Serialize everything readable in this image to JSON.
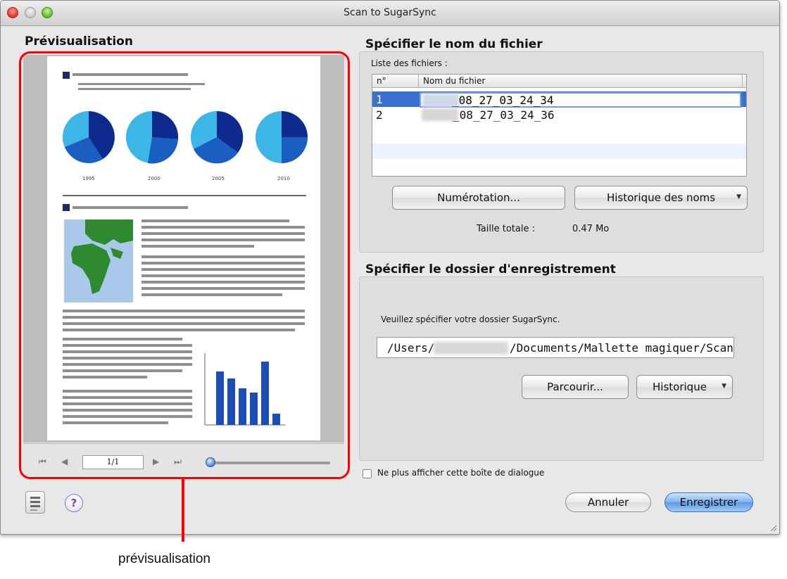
{
  "window": {
    "title": "Scan to SugarSync"
  },
  "preview": {
    "section_title": "Prévisualisation",
    "page_indicator": "1/1",
    "chart_years": [
      "1995",
      "2000",
      "2005",
      "2010"
    ],
    "zoom_level": 0.05
  },
  "filename": {
    "section_title": "Spécifier le nom du fichier",
    "list_label": "Liste des fichiers :",
    "columns": [
      "n°",
      "Nom du fichier"
    ],
    "rows": [
      {
        "num": "1",
        "name": "_08_27_03_24_34"
      },
      {
        "num": "2",
        "name": "_08_27_03_24_36"
      }
    ],
    "numbering_button": "Numérotation...",
    "history_button": "Historique des noms",
    "total_label": "Taille totale :",
    "total_value": "0.47  Mo"
  },
  "folder": {
    "section_title": "Spécifier le dossier d'enregistrement",
    "instruction": "Veuillez spécifier votre dossier SugarSync.",
    "path_start": "/Users/",
    "path_end": "/Documents/Mallette magiquer/ScanS",
    "browse_button": "Parcourir...",
    "history_button": "Historique"
  },
  "footer": {
    "checkbox_label": "Ne plus afficher cette boîte de dialogue",
    "cancel_button": "Annuler",
    "save_button": "Enregistrer"
  },
  "annotation": {
    "label": "prévisualisation"
  },
  "colors": {
    "accent": "#3a70d0",
    "callout": "#ff0000"
  }
}
